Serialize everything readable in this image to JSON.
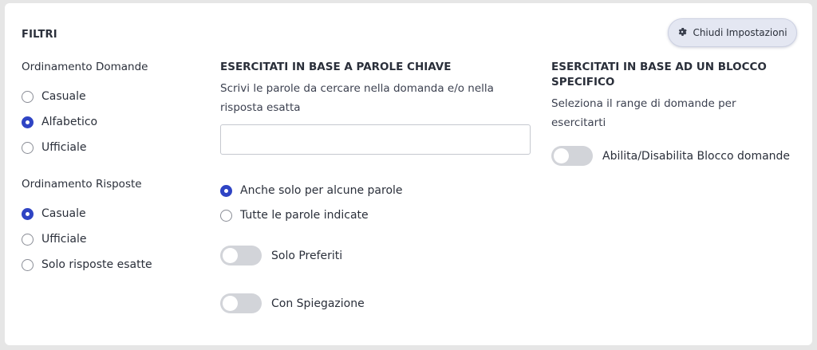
{
  "header": {
    "title": "FILTRI",
    "close_settings_label": "Chiudi Impostazioni"
  },
  "question_order": {
    "title": "Ordinamento Domande",
    "options": [
      {
        "label": "Casuale",
        "checked": false
      },
      {
        "label": "Alfabetico",
        "checked": true
      },
      {
        "label": "Ufficiale",
        "checked": false
      }
    ]
  },
  "answer_order": {
    "title": "Ordinamento Risposte",
    "options": [
      {
        "label": "Casuale",
        "checked": true
      },
      {
        "label": "Ufficiale",
        "checked": false
      },
      {
        "label": "Solo risposte esatte",
        "checked": false
      }
    ]
  },
  "keywords": {
    "title": "ESERCITATI IN BASE A PAROLE CHIAVE",
    "description_line1": "Scrivi le parole da cercare nella domanda e/o nella",
    "description_line2": "risposta esatta",
    "input_value": "",
    "options": [
      {
        "label": "Anche solo per alcune parole",
        "checked": true
      },
      {
        "label": "Tutte le parole indicate",
        "checked": false
      }
    ],
    "toggle_favorites": {
      "label": "Solo Preferiti",
      "on": false
    },
    "toggle_explanation": {
      "label": "Con Spiegazione",
      "on": false
    }
  },
  "block": {
    "title_line1": "ESERCITATI IN BASE AD UN BLOCCO",
    "title_line2": "SPECIFICO",
    "description_line1": "Seleziona il range di domande per",
    "description_line2": "esercitarti",
    "toggle": {
      "label": "Abilita/Disabilita Blocco domande",
      "on": false
    }
  },
  "colors": {
    "accent": "#2f44c4",
    "toggle_off": "#d2d4d9",
    "button_bg": "#e4e7f2"
  }
}
